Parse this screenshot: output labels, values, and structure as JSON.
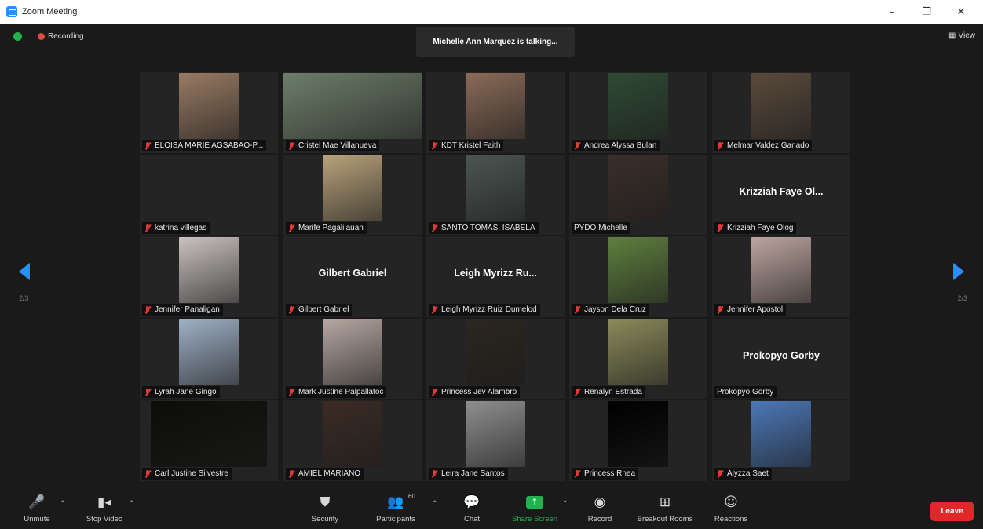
{
  "window": {
    "title": "Zoom Meeting",
    "minimize": "–",
    "restore": "❐",
    "close": "✕"
  },
  "top": {
    "recording": "Recording",
    "talking": "Michelle Ann Marquez is talking...",
    "view": "View"
  },
  "pager": {
    "left": "2/3",
    "right": "2/3"
  },
  "participants": [
    {
      "name": "ELOISA MARIE AGSABAO-P...",
      "photo": "#9a7b63",
      "photo_w": 76,
      "muted": true
    },
    {
      "name": "Cristel Mae Villanueva",
      "photo": "#6d7e6a",
      "photo_w": 176,
      "muted": true
    },
    {
      "name": "KDT Kristel Faith",
      "photo": "#8a6b58",
      "photo_w": 76,
      "muted": true
    },
    {
      "name": "Andrea Alyssa Bulan",
      "photo": "#2f4a34",
      "photo_w": 76,
      "muted": true
    },
    {
      "name": "Melmar Valdez Ganado",
      "photo": "#5a4a3c",
      "photo_w": 76,
      "muted": true
    },
    {
      "name": "katrina villegas",
      "muted": true
    },
    {
      "name": "Marife Pagalilauan",
      "photo": "#b8a27a",
      "photo_w": 76,
      "muted": true
    },
    {
      "name": "SANTO TOMAS, ISABELA",
      "photo": "#4c5553",
      "photo_w": 76,
      "muted": true
    },
    {
      "name": "PYDO Michelle",
      "photo": "#3a2e2a",
      "photo_w": 76,
      "muted": false
    },
    {
      "name": "Krizziah Faye Olog",
      "big": "Krizziah Faye Ol...",
      "muted": true
    },
    {
      "name": "Jennifer Panaligan",
      "photo": "#c9c2c0",
      "photo_w": 76,
      "muted": true
    },
    {
      "name": "Gilbert Gabriel",
      "big": "Gilbert Gabriel",
      "muted": true
    },
    {
      "name": "Leigh Myrizz Ruiz Dumelod",
      "big": "Leigh Myrizz Ru...",
      "muted": true
    },
    {
      "name": "Jayson Dela Cruz",
      "photo": "#5f7f3e",
      "photo_w": 76,
      "muted": true
    },
    {
      "name": "Jennifer Apostol",
      "photo": "#bda5a0",
      "photo_w": 76,
      "muted": true
    },
    {
      "name": "Lyrah Jane Gingo",
      "photo": "#9fb0c6",
      "photo_w": 76,
      "muted": true
    },
    {
      "name": "Mark Justine Palpallatoc",
      "photo": "#b6a7a2",
      "photo_w": 76,
      "muted": true
    },
    {
      "name": "Princess Jev Alambro",
      "photo": "#2b2620",
      "photo_w": 76,
      "muted": true
    },
    {
      "name": "Renalyn Estrada",
      "photo": "#8a8a5a",
      "photo_w": 76,
      "muted": true
    },
    {
      "name": "Prokopyo Gorby",
      "big": "Prokopyo Gorby",
      "muted": false
    },
    {
      "name": "Carl Justine Silvestre",
      "photo": "#0d0d08",
      "photo_w": 148,
      "muted": true
    },
    {
      "name": "AMIEL MARIANO",
      "photo": "#3b2b25",
      "photo_w": 76,
      "muted": true
    },
    {
      "name": "Leira Jane Santos",
      "photo": "#8f8f8f",
      "photo_w": 76,
      "muted": true
    },
    {
      "name": "Princess Rhea",
      "photo": "#000000",
      "photo_w": 76,
      "muted": true
    },
    {
      "name": "Alyzza Saet",
      "photo": "#4c78b8",
      "photo_w": 76,
      "muted": true
    }
  ],
  "toolbar": {
    "unmute": "Unmute",
    "stop_video": "Stop Video",
    "security": "Security",
    "participants": "Participants",
    "participants_count": "60",
    "chat": "Chat",
    "share": "Share Screen",
    "record": "Record",
    "breakout": "Breakout Rooms",
    "reactions": "Reactions",
    "leave": "Leave"
  },
  "colors": {
    "accent": "#2d8cff",
    "share_green": "#22b14c",
    "leave_red": "#e02828",
    "mute_red": "#e53935"
  }
}
